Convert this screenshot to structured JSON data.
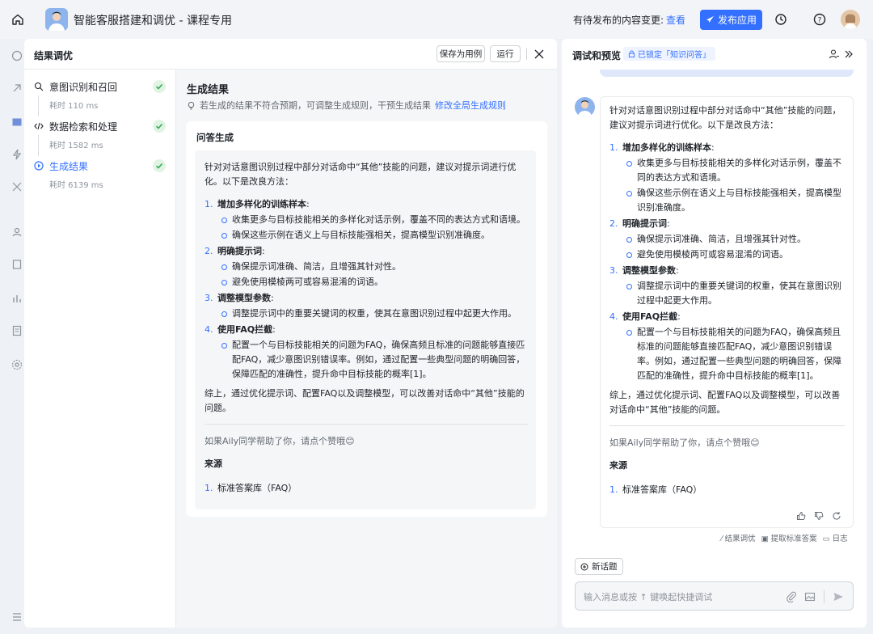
{
  "header": {
    "app_title": "智能客服搭建和调优 - 课程专用",
    "pending_text": "有待发布的内容变更:",
    "view_link": "查看",
    "publish_button": "发布应用"
  },
  "left_panel": {
    "title": "结果调优",
    "save_as_case_button": "保存为用例",
    "run_button": "运行",
    "steps": [
      {
        "label": "意图识别和召回",
        "time": "耗时 110 ms",
        "status": "done"
      },
      {
        "label": "数据检索和处理",
        "time": "耗时 1582 ms",
        "status": "done"
      },
      {
        "label": "生成结果",
        "time": "耗时 6139 ms",
        "status": "done",
        "active": true
      }
    ],
    "result": {
      "title": "生成结果",
      "tip": "若生成的结果不符合预期，可调整生成规则，干预生成结果",
      "tip_link": "修改全局生成规则",
      "card_title": "问答生成"
    }
  },
  "answer": {
    "intro": "针对对话意图识别过程中部分对话命中“其他”技能的问题，建议对提示词进行优化。以下是改良方法：",
    "items": [
      {
        "num": "1.",
        "title": "增加多样化的训练样本",
        "subs": [
          "收集更多与目标技能相关的多样化对话示例，覆盖不同的表达方式和语境。",
          "确保这些示例在语义上与目标技能强相关，提高模型识别准确度。"
        ]
      },
      {
        "num": "2.",
        "title": "明确提示词",
        "subs": [
          "确保提示词准确、简洁，且增强其针对性。",
          "避免使用模棱两可或容易混淆的词语。"
        ]
      },
      {
        "num": "3.",
        "title": "调整模型参数",
        "subs": [
          "调整提示词中的重要关键词的权重，使其在意图识别过程中起更大作用。"
        ]
      },
      {
        "num": "4.",
        "title": "使用FAQ拦截",
        "subs": [
          "配置一个与目标技能相关的问题为FAQ，确保高频且标准的问题能够直接匹配FAQ，减少意图识别错误率。例如，通过配置一些典型问题的明确回答，保障匹配的准确性，提升命中目标技能的概率[1]。"
        ]
      }
    ],
    "summary": "综上，通过优化提示词、配置FAQ以及调整模型，可以改善对话命中“其他”技能的问题。",
    "feedback": "如果Aily同学帮助了你，请点个赞哦😊",
    "source_heading": "来源",
    "sources": [
      {
        "num": "1.",
        "label": "标准答案库（FAQ）"
      }
    ]
  },
  "right_panel": {
    "title": "调试和预览",
    "lock_badge": "已锁定「知识问答」",
    "tools": {
      "tune": "结果调优",
      "extract": "提取标准答案",
      "log": "日志"
    },
    "new_topic": "新话题",
    "input_placeholder": "输入消息或按 ↑ 键唤起快捷调试"
  },
  "colors": {
    "accent": "#3370ff",
    "check": "#34a853",
    "panel_bg": "#f5f6f8"
  },
  "icons": [
    "home-icon",
    "rocket-icon",
    "history-icon",
    "help-icon",
    "close-icon",
    "check-icon",
    "lock-icon",
    "collapse-icon",
    "attach-icon",
    "image-icon",
    "send-icon",
    "thumbs-up-icon",
    "thumbs-down-icon",
    "refresh-icon"
  ]
}
